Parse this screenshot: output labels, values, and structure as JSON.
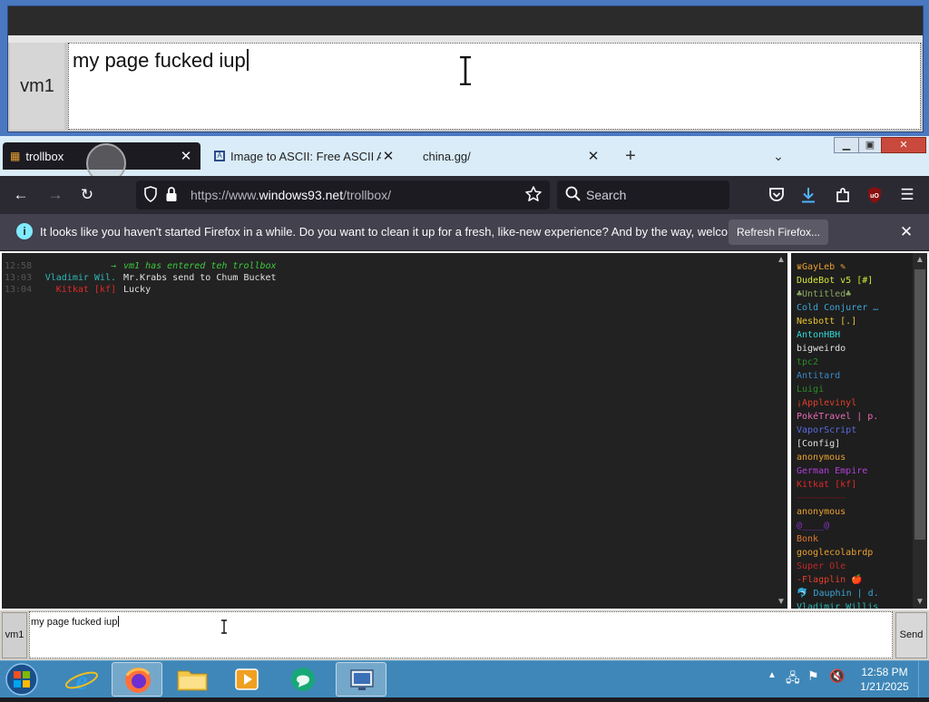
{
  "zoom": {
    "username": "vm1",
    "input_text": "my page fucked iup"
  },
  "tabs": [
    {
      "title": "trollbox",
      "active": true
    },
    {
      "title": "Image to ASCII: Free ASCII Art C",
      "active": false
    },
    {
      "title": "china.gg/",
      "active": false
    }
  ],
  "navbar": {
    "url_prefix": "https://www.",
    "url_domain": "windows93.net",
    "url_path": "/trollbox/",
    "search_placeholder": "Search"
  },
  "notification": {
    "text": "It looks like you haven't started Firefox in a while. Do you want to clean it up for a fresh, like-new experience? And by the way, welcome back!",
    "button": "Refresh Firefox..."
  },
  "messages": [
    {
      "time": "12:58",
      "nick": "→",
      "nick_color": "#3ec83e",
      "text": "vm1 has entered teh trollbox",
      "text_color": "#3ec83e",
      "italic": true
    },
    {
      "time": "13:03",
      "nick": "Vladimir Wil.",
      "nick_color": "#2fb8b8",
      "text": "Mr.Krabs send to Chum Bucket",
      "text_color": "#e0e0e0",
      "italic": false
    },
    {
      "time": "13:04",
      "nick": "Kitkat [kf]",
      "nick_color": "#e02828",
      "text": "Lucky",
      "text_color": "#e0e0e0",
      "italic": false
    }
  ],
  "users": [
    {
      "name": "♛GayLeb ✎",
      "color": "#e8a030"
    },
    {
      "name": "DudeBot v5 [#]",
      "color": "#d6e83a"
    },
    {
      "name": "♣Untitled♣",
      "color": "#8aa860"
    },
    {
      "name": "Cold Conjurer …",
      "color": "#3aa6d8"
    },
    {
      "name": "Nesbott [.]",
      "color": "#e8c430"
    },
    {
      "name": "AntonHBH",
      "color": "#30d8d8"
    },
    {
      "name": "bigweirdo",
      "color": "#e0e0e0"
    },
    {
      "name": "tpc2",
      "color": "#2a8a2a"
    },
    {
      "name": "Antitard",
      "color": "#3a88c8"
    },
    {
      "name": "Luigi",
      "color": "#2a8a2a"
    },
    {
      "name": "¡Applevinyl",
      "color": "#e0402a"
    },
    {
      "name": "PokéTravel | p.",
      "color": "#e86ab8"
    },
    {
      "name": "VaporScript",
      "color": "#5a6ae0"
    },
    {
      "name": "[Config]",
      "color": "#e0e0e0"
    },
    {
      "name": "anonymous",
      "color": "#e8a030"
    },
    {
      "name": "German Empire",
      "color": "#b040d8"
    },
    {
      "name": "Kitkat [kf]",
      "color": "#e02828"
    },
    {
      "name": "~~~~~~~~~",
      "color": "#7a1818"
    },
    {
      "name": "anonymous",
      "color": "#e8a030"
    },
    {
      "name": "@____@",
      "color": "#8a30c8"
    },
    {
      "name": "Bonk",
      "color": "#e07a30"
    },
    {
      "name": "googlecolabrdp",
      "color": "#e8a030"
    },
    {
      "name": "Super Ole",
      "color": "#c02828"
    },
    {
      "name": "-Flagplin 🍎",
      "color": "#e0402a"
    },
    {
      "name": "🐬 Dauphin | d.",
      "color": "#3aa6d8"
    },
    {
      "name": "Vladimir Willis",
      "color": "#2fb8b8"
    }
  ],
  "chat_input": {
    "username": "vm1",
    "value": "my page fucked iup",
    "send_label": "Send"
  },
  "taskbar": {
    "time": "12:58 PM",
    "date": "1/21/2025"
  },
  "colors": {
    "browser_chrome": "#2b2a33",
    "tabbar": "#d9ecf8",
    "taskbar": "#3f87b8",
    "chat_bg": "#222222"
  }
}
